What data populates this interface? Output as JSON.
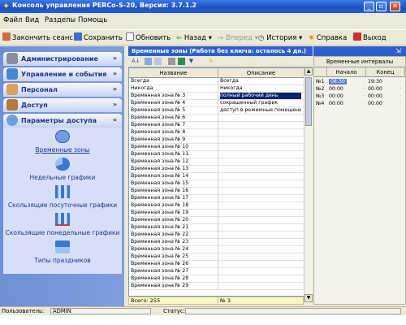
{
  "window": {
    "title": "Консоль управления PERCo-S-20, Версия: 3.7.1.2"
  },
  "menu": {
    "file": "Файл",
    "view": "Вид",
    "sections": "Разделы",
    "help": "Помощь"
  },
  "toolbar": {
    "end_session": "Закончить сеанс",
    "save": "Сохранить",
    "refresh": "Обновить",
    "back": "Назад",
    "forward": "Вперед",
    "history": "История",
    "help": "Справка",
    "exit": "Выход"
  },
  "nav": {
    "groups": [
      {
        "label": "Администрирование"
      },
      {
        "label": "Управление и события"
      },
      {
        "label": "Персонал"
      },
      {
        "label": "Доступ"
      },
      {
        "label": "Параметры доступа"
      }
    ],
    "items": [
      {
        "label": "Временные зоны"
      },
      {
        "label": "Недельные графики"
      },
      {
        "label": "Скользящие посуточные графики"
      },
      {
        "label": "Скользящие понедельные графики"
      },
      {
        "label": "Типы праздников"
      }
    ]
  },
  "content": {
    "header": "Временные зоны (Работа без ключа: осталось 4 дн.)",
    "columns": [
      "Название",
      "Описание"
    ],
    "rows": [
      {
        "name": "Всегда",
        "description": "Всегда"
      },
      {
        "name": "Никогда",
        "description": "Никогда"
      },
      {
        "name": "Временная зона № 3",
        "description": "полный рабочий день"
      },
      {
        "name": "Временная зона № 4",
        "description": "сокращенный график"
      },
      {
        "name": "Временная зона № 5",
        "description": "доступ в режимные помещения"
      },
      {
        "name": "Временная зона № 6",
        "description": ""
      },
      {
        "name": "Временная зона № 7",
        "description": ""
      },
      {
        "name": "Временная зона № 8",
        "description": ""
      },
      {
        "name": "Временная зона № 9",
        "description": ""
      },
      {
        "name": "Временная зона № 10",
        "description": ""
      },
      {
        "name": "Временная зона № 11",
        "description": ""
      },
      {
        "name": "Временная зона № 12",
        "description": ""
      },
      {
        "name": "Временная зона № 13",
        "description": ""
      },
      {
        "name": "Временная зона № 14",
        "description": ""
      },
      {
        "name": "Временная зона № 15",
        "description": ""
      },
      {
        "name": "Временная зона № 16",
        "description": ""
      },
      {
        "name": "Временная зона № 17",
        "description": ""
      },
      {
        "name": "Временная зона № 18",
        "description": ""
      },
      {
        "name": "Временная зона № 19",
        "description": ""
      },
      {
        "name": "Временная зона № 20",
        "description": ""
      },
      {
        "name": "Временная зона № 21",
        "description": ""
      },
      {
        "name": "Временная зона № 22",
        "description": ""
      },
      {
        "name": "Временная зона № 23",
        "description": ""
      },
      {
        "name": "Временная зона № 24",
        "description": ""
      },
      {
        "name": "Временная зона № 25",
        "description": ""
      },
      {
        "name": "Временная зона № 26",
        "description": ""
      },
      {
        "name": "Временная зона № 27",
        "description": ""
      },
      {
        "name": "Временная зона № 28",
        "description": ""
      },
      {
        "name": "Временная зона № 29",
        "description": ""
      }
    ],
    "selected_row": 2,
    "footer": {
      "total": "Всего: 255",
      "current": "№ 3"
    }
  },
  "intervals": {
    "title": "Временные интервалы",
    "columns": [
      "Начало",
      "Конец"
    ],
    "rows": [
      {
        "id": "№1",
        "start": "08:30",
        "end": "19:30"
      },
      {
        "id": "№2",
        "start": "00:00",
        "end": "00:00"
      },
      {
        "id": "№3",
        "start": "00:00",
        "end": "00:00"
      },
      {
        "id": "№4",
        "start": "00:00",
        "end": "00:00"
      }
    ]
  },
  "status": {
    "user_label": "Пользователь:",
    "user_value": "ADMIN",
    "status_label": "Статус:",
    "status_value": ""
  },
  "colors": {
    "title_bar": "#1b4fc2",
    "nav_background": "#7f9ee0",
    "selection": "#0a246a",
    "footer": "#fff6c4"
  }
}
